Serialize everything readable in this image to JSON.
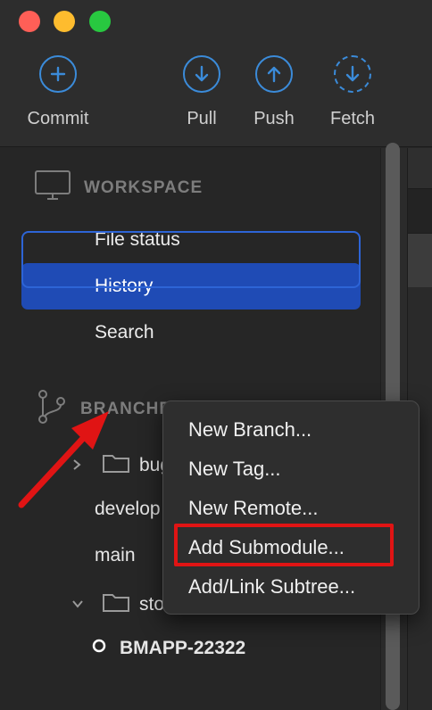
{
  "toolbar": {
    "commit_label": "Commit",
    "pull_label": "Pull",
    "push_label": "Push",
    "fetch_label": "Fetch"
  },
  "sidebar": {
    "workspace": {
      "heading": "WORKSPACE",
      "items": [
        {
          "label": "File status",
          "active": false
        },
        {
          "label": "History",
          "active": true
        },
        {
          "label": "Search",
          "active": false
        }
      ]
    },
    "branches": {
      "heading": "BRANCHES",
      "items": [
        {
          "label": "bugfix",
          "type": "folder",
          "expanded": false
        },
        {
          "label": "develop",
          "type": "branch"
        },
        {
          "label": "main",
          "type": "branch"
        },
        {
          "label": "story",
          "type": "folder",
          "expanded": true
        },
        {
          "label": "BMAPP-22322",
          "type": "current-branch"
        }
      ]
    }
  },
  "context_menu": {
    "items": [
      {
        "label": "New Branch..."
      },
      {
        "label": "New Tag..."
      },
      {
        "label": "New Remote..."
      },
      {
        "label": "Add Submodule...",
        "highlighted": true
      },
      {
        "label": "Add/Link Subtree..."
      }
    ]
  },
  "annotation": {
    "highlight_color": "#e01414",
    "accent_color": "#1f4bb5",
    "icon_color": "#3b8bd9"
  }
}
